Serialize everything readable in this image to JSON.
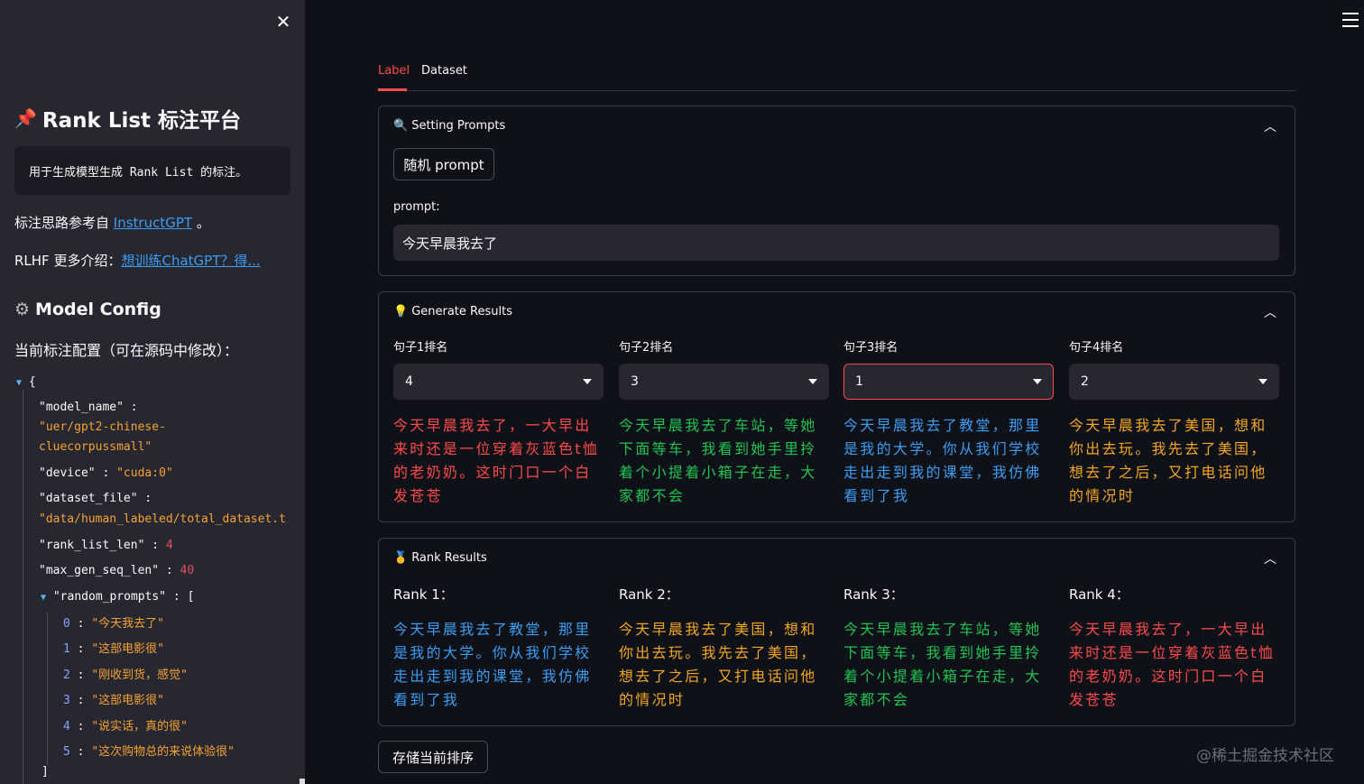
{
  "sidebar": {
    "title": "Rank List 标注平台",
    "description": "用于生成模型生成 Rank List 的标注。",
    "reference_prefix": "标注思路参考自 ",
    "reference_link": "InstructGPT",
    "reference_suffix": " 。",
    "rlhf_prefix": "RLHF 更多介绍：",
    "rlhf_link": "想训练ChatGPT？得...",
    "model_config_title": "Model Config",
    "config_caption": "当前标注配置（可在源码中修改）：",
    "config": {
      "open_brace": "{",
      "close_bracket": "]",
      "model_name_key": "\"model_name\"",
      "model_name_value_1": "\"uer/gpt2-chinese-",
      "model_name_value_2": "cluecorpussmall\"",
      "device_key": "\"device\"",
      "device_value": "\"cuda:0\"",
      "dataset_file_key": "\"dataset_file\"",
      "dataset_file_value": "\"data/human_labeled/total_dataset.t",
      "rank_list_len_key": "\"rank_list_len\"",
      "rank_list_len_value": "4",
      "max_gen_seq_len_key": "\"max_gen_seq_len\"",
      "max_gen_seq_len_value": "40",
      "random_prompts_key": "\"random_prompts\"",
      "random_prompts_open": "[",
      "random_prompts": [
        "\"今天我去了\"",
        "\"这部电影很\"",
        "\"刚收到货，感觉\"",
        "\"这部电影很\"",
        "\"说实话，真的很\"",
        "\"这次购物总的来说体验很\""
      ]
    }
  },
  "tabs": [
    "Label",
    "Dataset"
  ],
  "setting_prompts": {
    "title": "Setting Prompts",
    "random_button": "随机 prompt",
    "prompt_label": "prompt:",
    "prompt_value": "今天早晨我去了"
  },
  "generate_results": {
    "title": "Generate Results",
    "columns": [
      {
        "label": "句子1排名",
        "rank": "4",
        "text": "今天早晨我去了，一大早出来时还是一位穿着灰蓝色t恤的老奶奶。这时门口一个白发苍苍",
        "color": "#ff4b4b"
      },
      {
        "label": "句子2排名",
        "rank": "3",
        "text": "今天早晨我去了车站，等她下面等车，我看到她手里拎着个小提着小箱子在走，大家都不会",
        "color": "#21c354"
      },
      {
        "label": "句子3排名",
        "rank": "1",
        "text": "今天早晨我去了教堂，那里是我的大学。你从我们学校走出走到我的课堂，我仿佛看到了我",
        "color": "#3d9df3"
      },
      {
        "label": "句子4排名",
        "rank": "2",
        "text": "今天早晨我去了美国，想和你出去玩。我先去了美国，想去了之后，又打电话问他的情况时",
        "color": "#f5a623"
      }
    ]
  },
  "rank_results": {
    "title": "Rank Results",
    "columns": [
      {
        "label": "Rank 1：",
        "text": "今天早晨我去了教堂，那里是我的大学。你从我们学校走出走到我的课堂，我仿佛看到了我",
        "color": "#3d9df3"
      },
      {
        "label": "Rank 2：",
        "text": "今天早晨我去了美国，想和你出去玩。我先去了美国，想去了之后，又打电话问他的情况时",
        "color": "#f5a623"
      },
      {
        "label": "Rank 3：",
        "text": "今天早晨我去了车站，等她下面等车，我看到她手里拎着个小提着小箱子在走，大家都不会",
        "color": "#21c354"
      },
      {
        "label": "Rank 4：",
        "text": "今天早晨我去了，一大早出来时还是一位穿着灰蓝色t恤的老奶奶。这时门口一个白发苍苍",
        "color": "#ff4b4b"
      }
    ]
  },
  "save_button": "存储当前排序",
  "watermark": "@稀土掘金技术社区",
  "icons": {
    "close": "close-icon",
    "menu": "hamburger-menu-icon",
    "pin": "pushpin-icon",
    "gear": "gear-icon",
    "search": "magnifier-icon",
    "bulb": "lightbulb-icon",
    "medal": "medal-icon",
    "collapse": "chevron-up-icon"
  }
}
